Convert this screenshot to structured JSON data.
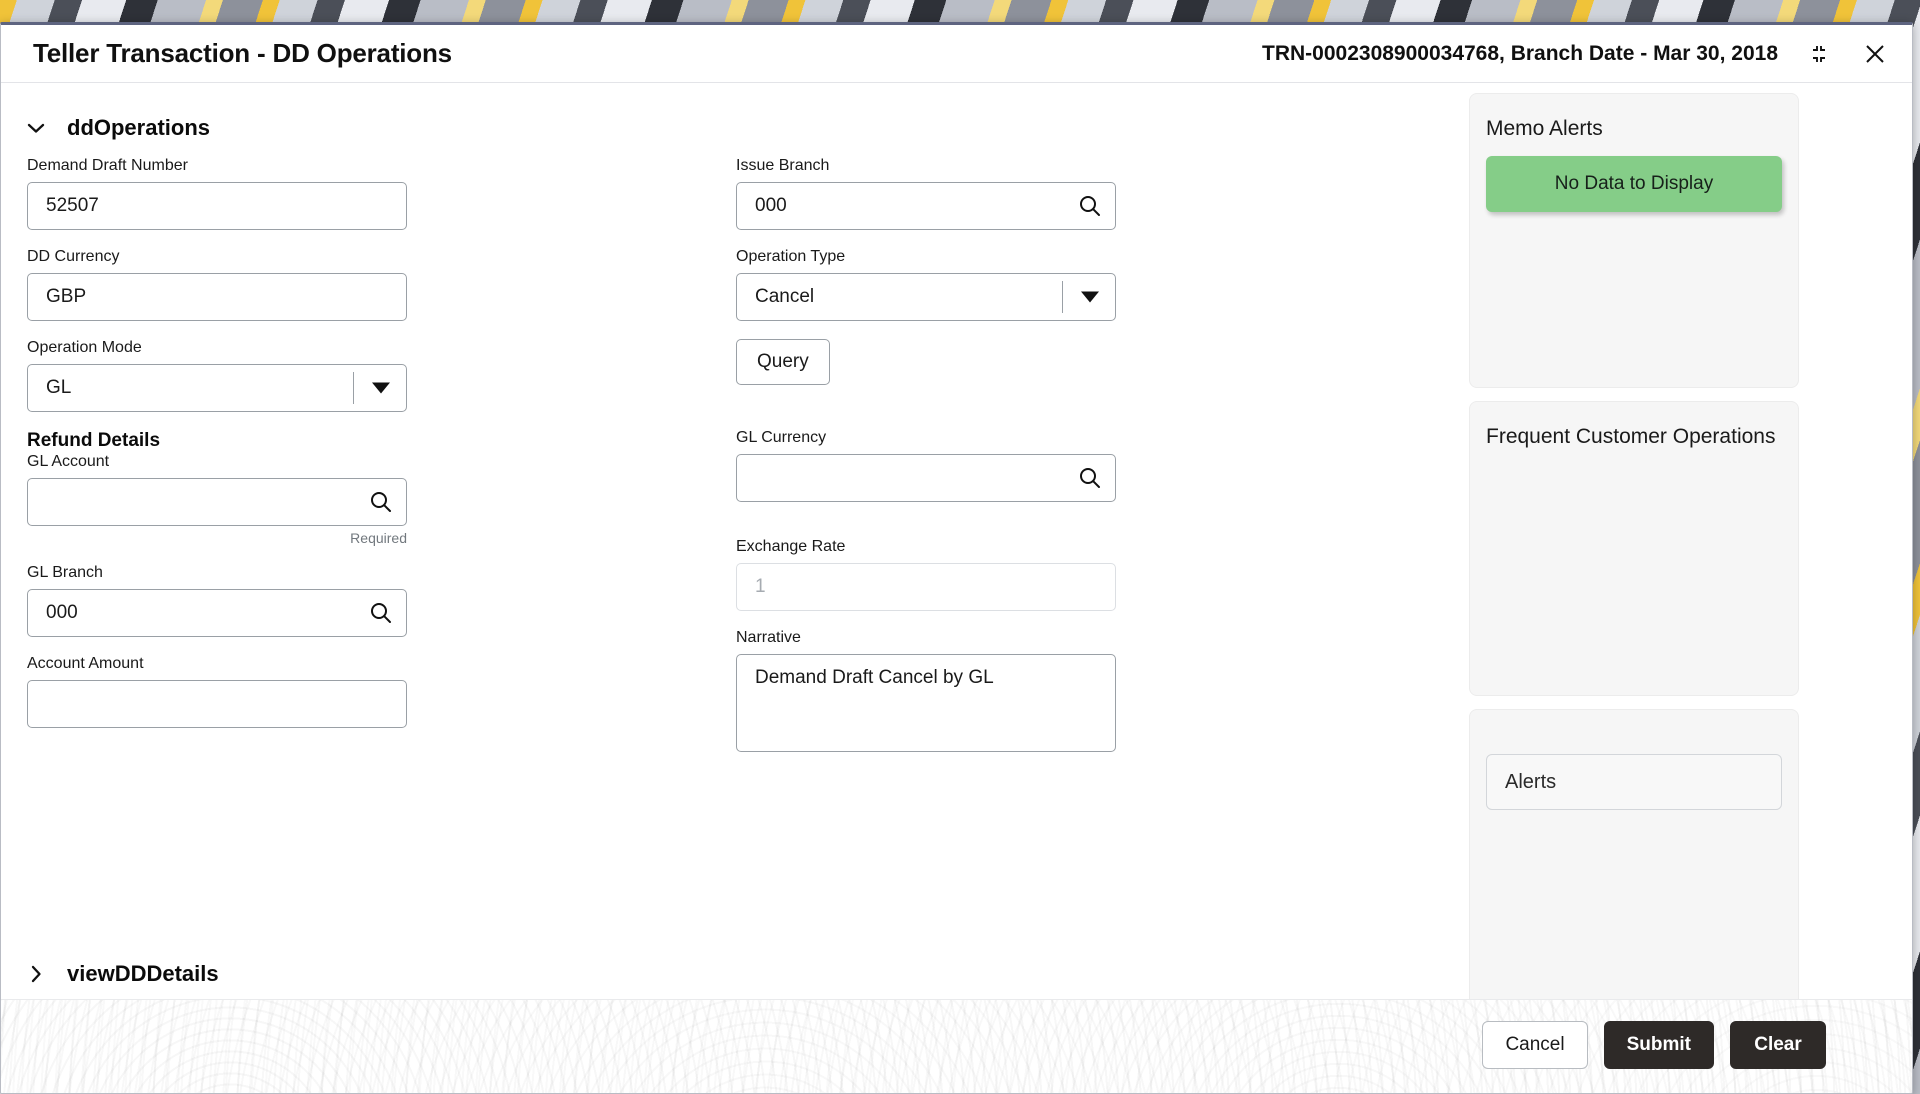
{
  "header": {
    "title": "Teller Transaction - DD Operations",
    "transaction_info": "TRN-0002308900034768, Branch Date - Mar 30, 2018",
    "minimize_icon": "collapse-window-icon",
    "close_icon": "close-icon"
  },
  "sections": {
    "primary": {
      "label": "ddOperations",
      "expanded": true,
      "chevron_icon": "chevron-down-icon"
    },
    "secondary": {
      "label": "viewDDDetails",
      "expanded": false,
      "chevron_icon": "chevron-right-icon"
    }
  },
  "form": {
    "group_heading": "Refund Details",
    "left_column": [
      {
        "label": "Demand Draft Number",
        "value": "52507",
        "type": "text",
        "icon": null,
        "hint": null
      },
      {
        "label": "DD Currency",
        "value": "GBP",
        "type": "text",
        "icon": null,
        "hint": null
      },
      {
        "label": "Operation Mode",
        "value": "GL",
        "type": "select",
        "icon": "chevron-down-icon",
        "hint": null
      },
      {
        "label": "GL Account",
        "value": "",
        "type": "lookup",
        "icon": "search-icon",
        "hint": "Required"
      },
      {
        "label": "GL Branch",
        "value": "000",
        "type": "lookup",
        "icon": "search-icon",
        "hint": null
      },
      {
        "label": "Account Amount",
        "value": "",
        "type": "text",
        "icon": null,
        "hint": null
      }
    ],
    "right_column": [
      {
        "label": "Issue Branch",
        "value": "000",
        "type": "lookup",
        "icon": "search-icon",
        "hint": null
      },
      {
        "label": "Operation Type",
        "value": "Cancel",
        "type": "select",
        "icon": "chevron-down-icon",
        "hint": null
      },
      {
        "label": "GL Currency",
        "value": "",
        "type": "lookup",
        "icon": "search-icon",
        "hint": null
      },
      {
        "label": "Exchange Rate",
        "value": "",
        "placeholder": "1",
        "type": "text-disabled",
        "icon": null,
        "hint": null
      },
      {
        "label": "Narrative",
        "value": "Demand Draft Cancel by GL",
        "type": "textarea",
        "icon": null,
        "hint": null
      }
    ],
    "query_button": "Query"
  },
  "sidebar": {
    "memo_alerts": {
      "title": "Memo Alerts",
      "banner_text": "No Data to Display",
      "banner_color": "#85cd88"
    },
    "frequent_customer_operations": {
      "title": "Frequent Customer Operations"
    },
    "alerts": {
      "box_label": "Alerts"
    }
  },
  "footer": {
    "cancel": "Cancel",
    "submit": "Submit",
    "clear": "Clear"
  }
}
